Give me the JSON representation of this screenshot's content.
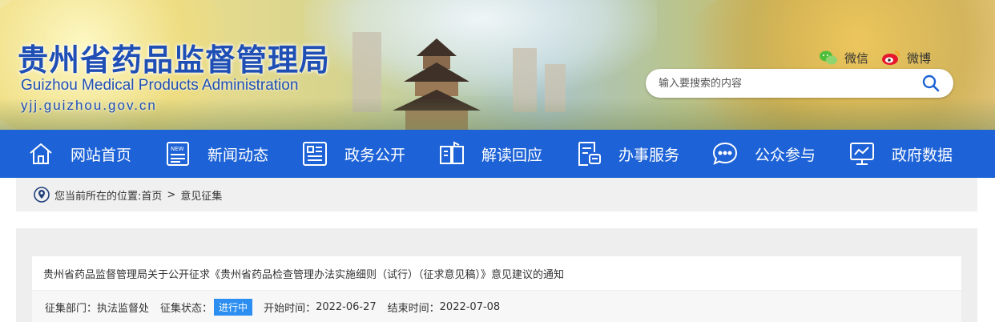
{
  "header": {
    "title_cn": "贵州省药品监督管理局",
    "title_en": "Guizhou Medical Products Administration",
    "url": "yjj.guizhou.gov.cn",
    "wechat_label": "微信",
    "weibo_label": "微博",
    "search_placeholder": "输入要搜索的内容"
  },
  "nav": {
    "items": [
      {
        "label": "网站首页",
        "icon": "home-icon"
      },
      {
        "label": "新闻动态",
        "icon": "news-icon"
      },
      {
        "label": "政务公开",
        "icon": "document-icon"
      },
      {
        "label": "解读回应",
        "icon": "book-icon"
      },
      {
        "label": "办事服务",
        "icon": "form-icon"
      },
      {
        "label": "公众参与",
        "icon": "chat-icon"
      },
      {
        "label": "政府数据",
        "icon": "data-icon"
      }
    ]
  },
  "breadcrumb": {
    "prefix": "您当前所在的位置:",
    "home": "首页",
    "separator": ">",
    "current": "意见征集"
  },
  "notice": {
    "title": "贵州省药品监督管理局关于公开征求《贵州省药品检查管理办法实施细则（试行）（征求意见稿）》意见建议的通知",
    "dept_label": "征集部门：",
    "dept": "执法监督处",
    "status_label": "征集状态：",
    "status": "进行中",
    "start_label": "开始时间：",
    "start": "2022-06-27",
    "end_label": "结束时间：",
    "end": "2022-07-08"
  },
  "colors": {
    "nav_bg": "#1d62d6",
    "title_blue": "#1f4fb5",
    "status_badge": "#2b8ef0"
  }
}
